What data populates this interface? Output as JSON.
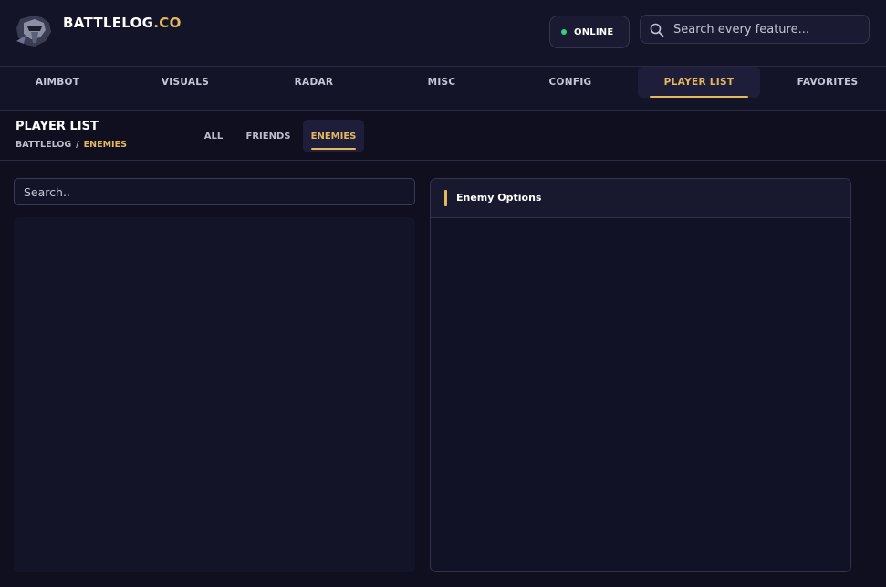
{
  "brand": {
    "name": "BATTLELOG",
    "tld": ".CO"
  },
  "status": {
    "label": "ONLINE",
    "color": "#35d07f"
  },
  "search": {
    "placeholder": "Search every feature..."
  },
  "nav": {
    "tabs": [
      {
        "label": "AIMBOT"
      },
      {
        "label": "VISUALS"
      },
      {
        "label": "RADAR"
      },
      {
        "label": "MISC"
      },
      {
        "label": "CONFIG"
      },
      {
        "label": "PLAYER LIST",
        "active": true
      },
      {
        "label": "FAVORITES"
      }
    ]
  },
  "page": {
    "title": "PLAYER LIST",
    "breadcrumb": {
      "root": "BATTLELOG",
      "separator": "/",
      "current": "ENEMIES"
    }
  },
  "filters": {
    "tabs": [
      {
        "label": "ALL"
      },
      {
        "label": "FRIENDS"
      },
      {
        "label": "ENEMIES",
        "active": true
      }
    ]
  },
  "player_search": {
    "placeholder": "Search.."
  },
  "options_panel": {
    "title": "Enemy Options"
  },
  "theme": {
    "accent": "#e6b85c",
    "background": "#0f0f1f",
    "panel": "#141428"
  },
  "icons": {
    "logo": "knight-helmet-icon",
    "search": "search-icon",
    "status": "status-dot-icon"
  }
}
